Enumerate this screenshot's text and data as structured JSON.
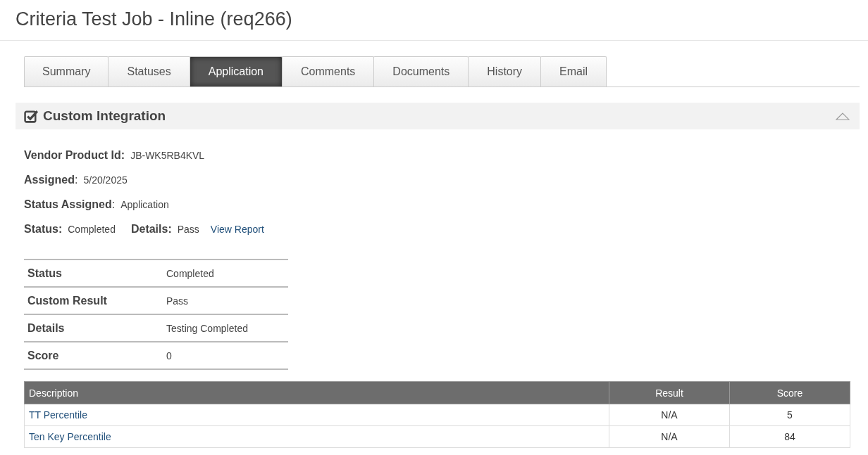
{
  "page_title": "Criteria Test Job - Inline (req266)",
  "tabs": [
    {
      "label": "Summary",
      "selected": false
    },
    {
      "label": "Statuses",
      "selected": false
    },
    {
      "label": "Application",
      "selected": true
    },
    {
      "label": "Comments",
      "selected": false
    },
    {
      "label": "Documents",
      "selected": false
    },
    {
      "label": "History",
      "selected": false
    },
    {
      "label": "Email",
      "selected": false
    }
  ],
  "section": {
    "title": "Custom Integration",
    "expanded": true,
    "fields": [
      {
        "label": "Vendor Product Id:",
        "value": "JB-WK5RB4KVL"
      },
      {
        "label": "**Assigned**:",
        "value": "5/20/2025"
      },
      {
        "label": "**Status Assigned**:",
        "value": "Application"
      }
    ],
    "status_line": {
      "status_label": "Status:",
      "status_value": "Completed",
      "details_label": "Details:",
      "details_value": "Pass",
      "link": "View Report"
    },
    "result_table": [
      {
        "label": "Status",
        "value": "Completed"
      },
      {
        "label": "Custom Result",
        "value": "Pass"
      },
      {
        "label": "Details",
        "value": "Testing Completed"
      },
      {
        "label": "Score",
        "value": "0"
      }
    ],
    "score_table": {
      "columns": [
        "Description",
        "Result",
        "Score"
      ],
      "rows": [
        [
          "TT Percentile",
          "N/A",
          "5"
        ],
        [
          "Ten Key Percentile",
          "N/A",
          "84"
        ]
      ]
    }
  }
}
